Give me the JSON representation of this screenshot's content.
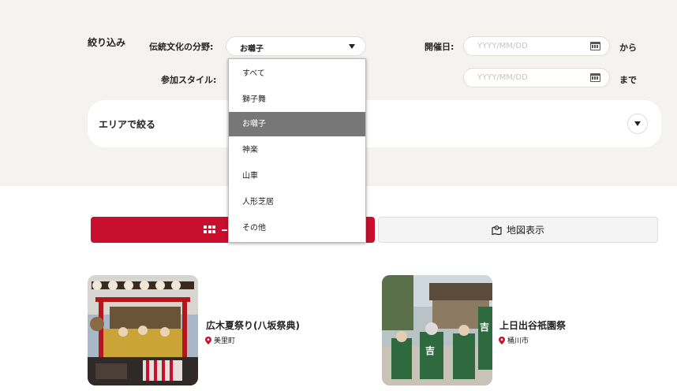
{
  "filters": {
    "heading": "絞り込み",
    "genre_label": "伝統文化の分野:",
    "genre_value": "お囃子",
    "participation_label": "参加スタイル:",
    "date_label": "開催日:",
    "date_from_placeholder": "YYYY/MM/DD",
    "date_to_placeholder": "YYYY/MM/DD",
    "from_suffix": "から",
    "to_suffix": "まで",
    "area_label": "エリアで絞る"
  },
  "dropdown": {
    "options": [
      "すべて",
      "獅子舞",
      "お囃子",
      "神楽",
      "山車",
      "人形芝居",
      "その他"
    ],
    "selected": "お囃子"
  },
  "view_toggle": {
    "map_label": "地図表示"
  },
  "results": [
    {
      "title": "広木夏祭り(八坂祭典)",
      "location": "美里町"
    },
    {
      "title": "上日出谷祇園祭",
      "location": "桶川市"
    }
  ],
  "colors": {
    "accent": "#c8102e",
    "panel_bg": "#f5f3ef",
    "selected_option_bg": "#777777"
  }
}
